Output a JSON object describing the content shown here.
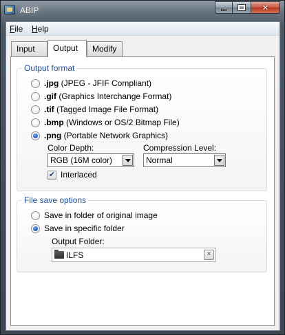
{
  "window": {
    "title": "ABIP"
  },
  "menu": {
    "items": [
      {
        "label_u": "F",
        "label_rest": "ile"
      },
      {
        "label_u": "H",
        "label_rest": "elp"
      }
    ]
  },
  "tabs": [
    {
      "label": "Input",
      "active": false
    },
    {
      "label": "Output",
      "active": true
    },
    {
      "label": "Modify",
      "active": false
    }
  ],
  "output_format": {
    "legend": "Output format",
    "options": [
      {
        "ext": ".jpg",
        "desc": "(JPEG - JFIF Compliant)",
        "checked": false
      },
      {
        "ext": ".gif",
        "desc": "(Graphics Interchange Format)",
        "checked": false
      },
      {
        "ext": ".tif",
        "desc": "(Tagged Image File Format)",
        "checked": false
      },
      {
        "ext": ".bmp",
        "desc": "(Windows or OS/2 Bitmap File)",
        "checked": false
      },
      {
        "ext": ".png",
        "desc": "(Portable Network Graphics)",
        "checked": true
      }
    ],
    "color_depth_label": "Color Depth:",
    "color_depth_value": "RGB (16M color)",
    "compression_label": "Compression Level:",
    "compression_value": "Normal",
    "interlaced_label": "Interlaced",
    "interlaced_checked": true
  },
  "file_save": {
    "legend": "File save options",
    "options": [
      {
        "label": "Save in folder of original image",
        "checked": false
      },
      {
        "label": "Save in specific folder",
        "checked": true
      }
    ],
    "output_folder_label": "Output Folder:",
    "output_folder_value": "ILFS",
    "clear_glyph": "×"
  },
  "icons": {
    "app": "abip-app-icon",
    "folder": "folder-icon",
    "clear": "clear-icon"
  },
  "colors": {
    "legend_blue": "#1a4fa8",
    "radio_selected": "#1d5fc4",
    "close_red": "#c9533c"
  }
}
